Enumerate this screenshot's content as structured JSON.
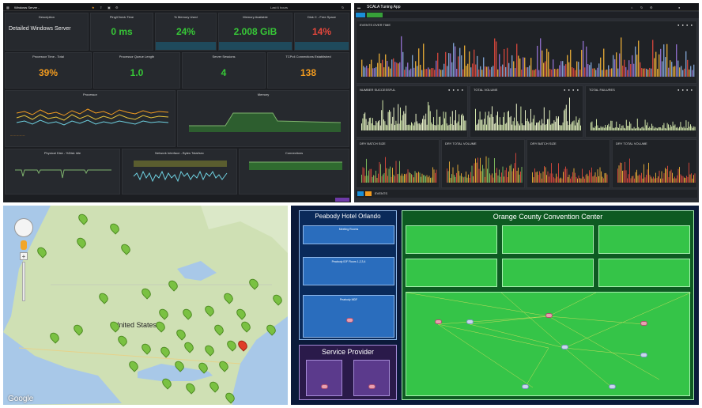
{
  "windows": {
    "title": "Windows Server - ",
    "status_text": "Last 6 hours",
    "panels": {
      "description": {
        "title": "Description",
        "value": "Detailed Windows Server"
      },
      "ping": {
        "title": "Ping/Check Time",
        "value": "0 ms"
      },
      "memory_used": {
        "title": "% Memory Used",
        "value": "24%"
      },
      "memory_available": {
        "title": "Memory Available",
        "value": "2.008 GiB"
      },
      "disk_free": {
        "title": "Disk C - Free Space",
        "value": "14%"
      },
      "processor_time": {
        "title": "Processor Time - Total",
        "value": "39%"
      },
      "processor_queue": {
        "title": "Processor Queue Length",
        "value": "1.0"
      },
      "server_sessions": {
        "title": "Server Sessions",
        "value": "4"
      },
      "tcp_connections": {
        "title": "TCPv4 Connections Established",
        "value": "138"
      },
      "processor_chart": {
        "title": "Processor"
      },
      "memory_chart": {
        "title": "Memory"
      },
      "physical_disk": {
        "title": "Physical Disk - %Disk Idle"
      },
      "network_interface": {
        "title": "Network Interface - Bytes Total/sec"
      },
      "connections": {
        "title": "Connections"
      }
    },
    "colors": {
      "green": "#37c837",
      "orange": "#f29b1f",
      "red": "#e5473c"
    }
  },
  "scala": {
    "title": "SCALA Tuning App",
    "panels": {
      "events_over_time": {
        "title": "EVENTS OVER TIME"
      },
      "number_successful": {
        "title": "NUMBER SUCCESSFUL"
      },
      "total_volume_1": {
        "title": "TOTAL VOLUME"
      },
      "total_failures": {
        "title": "TOTAL FAILURES"
      },
      "dry_batch_size_1": {
        "title": "DRY BATCH SIZE"
      },
      "dry_total_volume": {
        "title": "DRY TOTAL VOLUME"
      },
      "dry_batch_size_2": {
        "title": "DRY BATCH SIZE"
      },
      "dry_total_volume_2": {
        "title": "DRY TOTAL VOLUME"
      },
      "events": {
        "title": "EVENTS"
      }
    }
  },
  "map": {
    "country_label": "United States",
    "brand": "Google",
    "colors": {
      "land": "#cfe0b4",
      "water": "#a8c8e8",
      "pin": "#7ac142",
      "alert_pin": "#e03c28"
    }
  },
  "network": {
    "peabody": {
      "title": "Peabody Hotel Orlando",
      "meeting_rooms": "Meeting Rooms",
      "idf_floors": "Peabody IDF Floors 1,2,3,4",
      "mdf": "Peabody MDF"
    },
    "service_provider": {
      "title": "Service Provider"
    },
    "occc": {
      "title": "Orange County Convention Center"
    },
    "colors": {
      "blue": "#2a6dbd",
      "green": "#35c448",
      "purple": "#5b3a8c"
    }
  }
}
